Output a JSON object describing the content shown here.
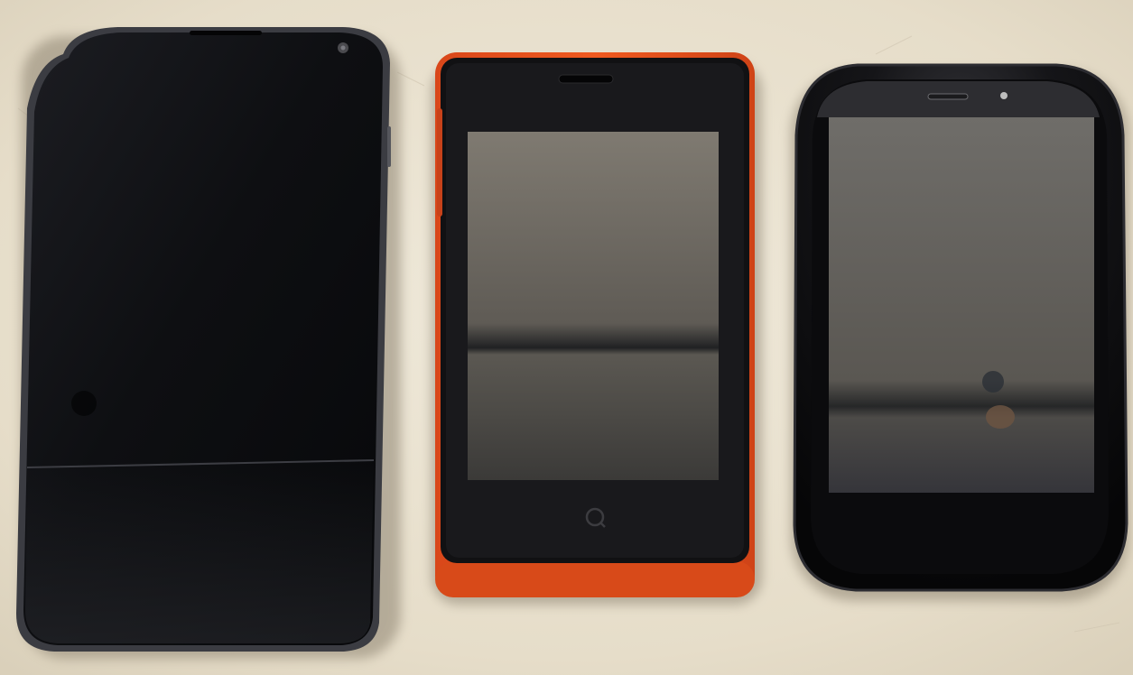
{
  "scene": {
    "background_color": "#e9e2d2",
    "phones": [
      {
        "name": "left-phone",
        "body_color": "#141416",
        "screen_state": "off",
        "visible_features": [
          "earpiece-slot",
          "front-camera"
        ]
      },
      {
        "name": "middle-phone",
        "body_color": "#e5551e",
        "bezel_color": "#111113",
        "screen_state": "off",
        "visible_features": [
          "earpiece-slot",
          "home-button-circle"
        ]
      },
      {
        "name": "right-phone",
        "body_color": "#0d0d0f",
        "screen_state": "off",
        "visible_features": [
          "earpiece-slot",
          "front-camera"
        ]
      }
    ]
  }
}
